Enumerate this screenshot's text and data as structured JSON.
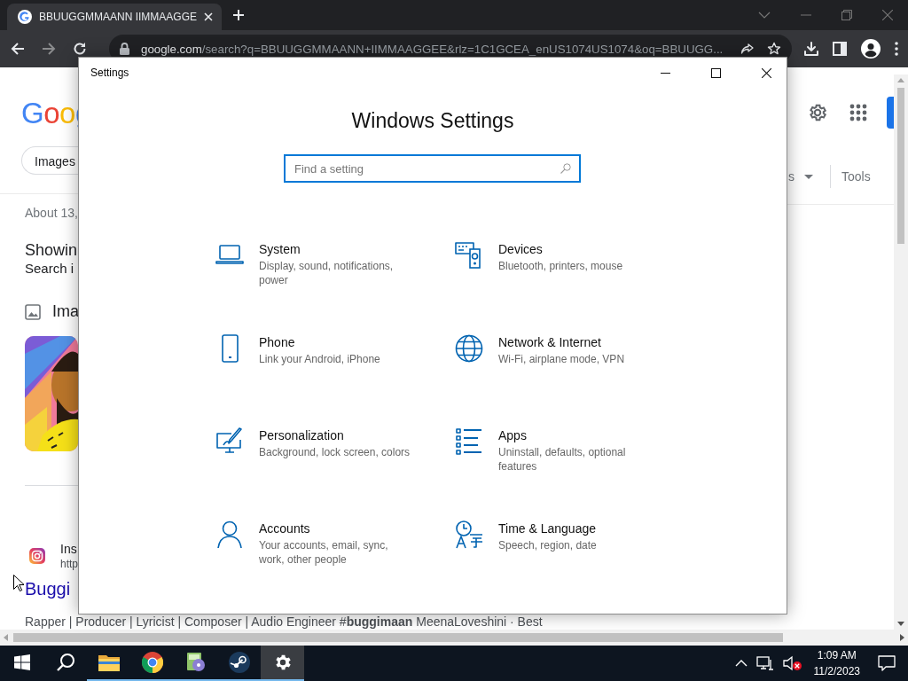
{
  "browser": {
    "tab": {
      "title": "BBUUGGMMAANN IIMMAAGGE",
      "selected": true
    },
    "nav": [
      {
        "kind": "back",
        "disabled": false
      },
      {
        "kind": "forward",
        "disabled": true
      },
      {
        "kind": "reload",
        "disabled": false
      }
    ],
    "address": {
      "host": "google.com",
      "path": "/search?q=BBUUGGMMAANN+IIMMAAGGEE&rlz=1C1GCEA_enUS1074US1074&oq=BBUUGG..."
    }
  },
  "page": {
    "logo": "Goog",
    "chip": "Images",
    "result_count": "About 13,",
    "notice_title": "Showin",
    "notice_text": "Search i",
    "images_heading": "Ima",
    "source_name": "Ins",
    "source_url": "http",
    "result_title": "Buggi",
    "result_snippet": "Rapper | Producer | Lyricist | Composer | Audio Engineer #**buggimaan** MeenaLoveshini · Best",
    "menu_fragment": "s",
    "tools": "Tools"
  },
  "settings_window": {
    "title": "Settings",
    "heading": "Windows Settings",
    "search": {
      "placeholder": "Find a setting"
    },
    "categories": [
      {
        "kind": "system",
        "name": "System",
        "description": "Display, sound, notifications, power"
      },
      {
        "kind": "devices",
        "name": "Devices",
        "description": "Bluetooth, printers, mouse"
      },
      {
        "kind": "phone",
        "name": "Phone",
        "description": "Link your Android, iPhone"
      },
      {
        "kind": "network",
        "name": "Network & Internet",
        "description": "Wi-Fi, airplane mode, VPN"
      },
      {
        "kind": "personalization",
        "name": "Personalization",
        "description": "Background, lock screen, colors"
      },
      {
        "kind": "apps",
        "name": "Apps",
        "description": "Uninstall, defaults, optional features"
      },
      {
        "kind": "accounts",
        "name": "Accounts",
        "description": "Your accounts, email, sync, work, other people"
      },
      {
        "kind": "time",
        "name": "Time & Language",
        "description": "Speech, region, date"
      }
    ]
  },
  "taskbar": {
    "items": [
      {
        "kind": "start",
        "running": false,
        "selected": false
      },
      {
        "kind": "search",
        "running": false,
        "selected": false
      },
      {
        "kind": "explorer",
        "running": true,
        "selected": false
      },
      {
        "kind": "chrome",
        "running": true,
        "selected": false
      },
      {
        "kind": "media",
        "running": true,
        "selected": false
      },
      {
        "kind": "steam",
        "running": true,
        "selected": false
      },
      {
        "kind": "settings",
        "running": true,
        "selected": true
      }
    ],
    "tray": {
      "volume_muted": true,
      "time": "1:09 AM",
      "date": "11/2/2023"
    }
  }
}
